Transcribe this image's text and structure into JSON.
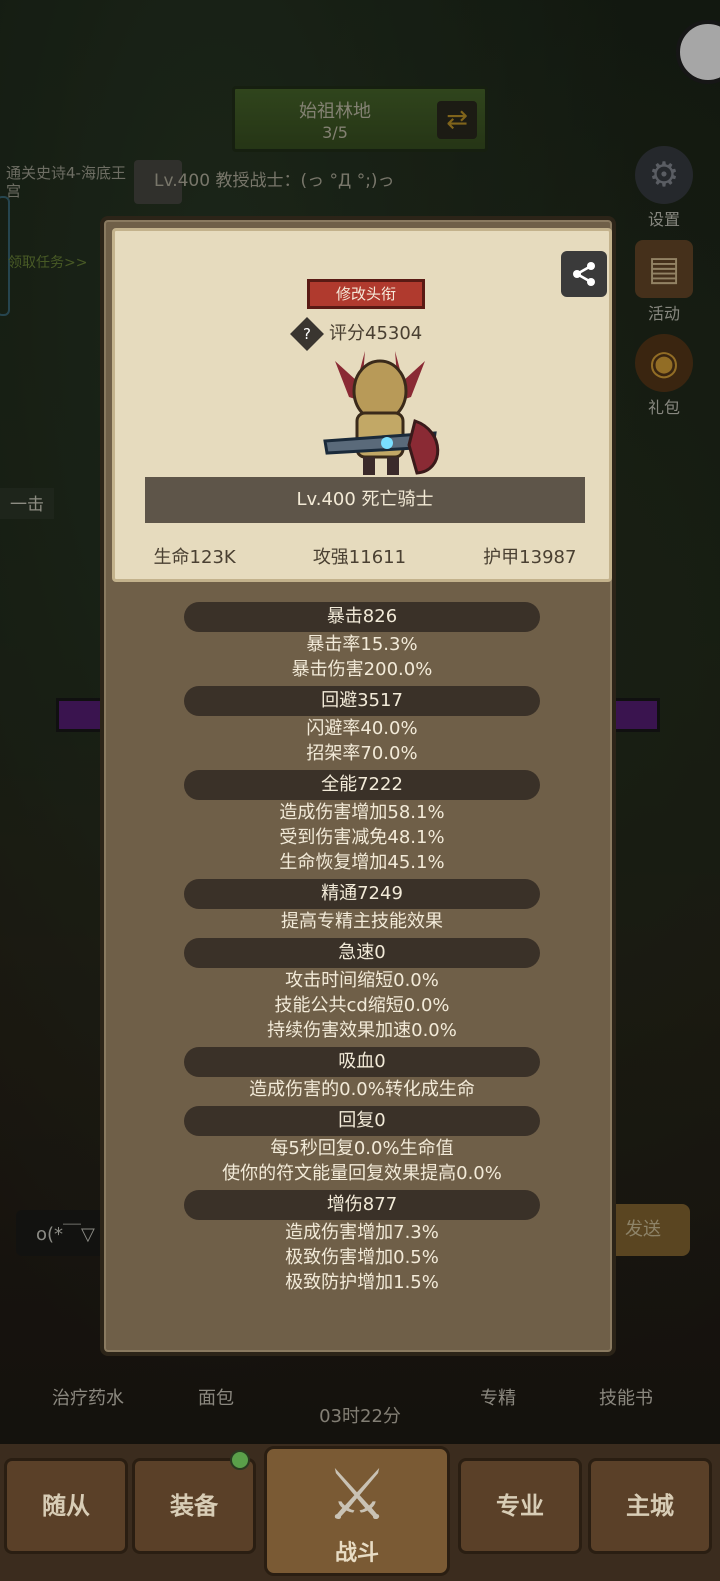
{
  "colors": {
    "modal_bg": "#6f5f48",
    "card_bg": "#e6dbbe",
    "title_button": "#b03a2e",
    "pill": "#3a3128",
    "text_light": "#f2ead8",
    "text_dark": "#4a4032"
  },
  "background": {
    "area_name": "始祖林地",
    "area_progress": "3/5",
    "quest_text": "通关史诗4-海底王宫",
    "quest_link": "领取任务>>",
    "chat_line": "Lv.400 教授战士：(っ °Д °;)っ",
    "strike_label": "一击",
    "chat_input": "o(*￣▽",
    "send_label": "发送",
    "side_buttons": [
      {
        "label": "设置",
        "icon": "gear-icon"
      },
      {
        "label": "活动",
        "icon": "scroll-icon"
      },
      {
        "label": "礼包",
        "icon": "gift-icon"
      }
    ],
    "quick_items": [
      "治疗药水",
      "面包",
      "专精",
      "技能书"
    ],
    "timer": "03时22分"
  },
  "nav": {
    "items": [
      "随从",
      "装备",
      "战斗",
      "专业",
      "主城"
    ]
  },
  "profile": {
    "title_button": "修改头衔",
    "score": "评分45304",
    "score_help_icon": "question-icon",
    "share_icon": "share-icon",
    "hero_name": "Lv.400 死亡骑士",
    "hp": "生命123K",
    "attack": "攻强11611",
    "armor": "护甲13987"
  },
  "stat_groups": [
    {
      "head": "暴击826",
      "lines": [
        "暴击率15.3%",
        "暴击伤害200.0%"
      ]
    },
    {
      "head": "回避3517",
      "lines": [
        "闪避率40.0%",
        "招架率70.0%"
      ]
    },
    {
      "head": "全能7222",
      "lines": [
        "造成伤害增加58.1%",
        "受到伤害减免48.1%",
        "生命恢复增加45.1%"
      ]
    },
    {
      "head": "精通7249",
      "lines": [
        "提高专精主技能效果"
      ]
    },
    {
      "head": "急速0",
      "lines": [
        "攻击时间缩短0.0%",
        "技能公共cd缩短0.0%",
        "持续伤害效果加速0.0%"
      ]
    },
    {
      "head": "吸血0",
      "lines": [
        "造成伤害的0.0%转化成生命"
      ]
    },
    {
      "head": "回复0",
      "lines": [
        "每5秒回复0.0%生命值",
        "使你的符文能量回复效果提高0.0%"
      ]
    },
    {
      "head": "增伤877",
      "lines": [
        "造成伤害增加7.3%",
        "极致伤害增加0.5%",
        "极致防护增加1.5%"
      ]
    }
  ]
}
